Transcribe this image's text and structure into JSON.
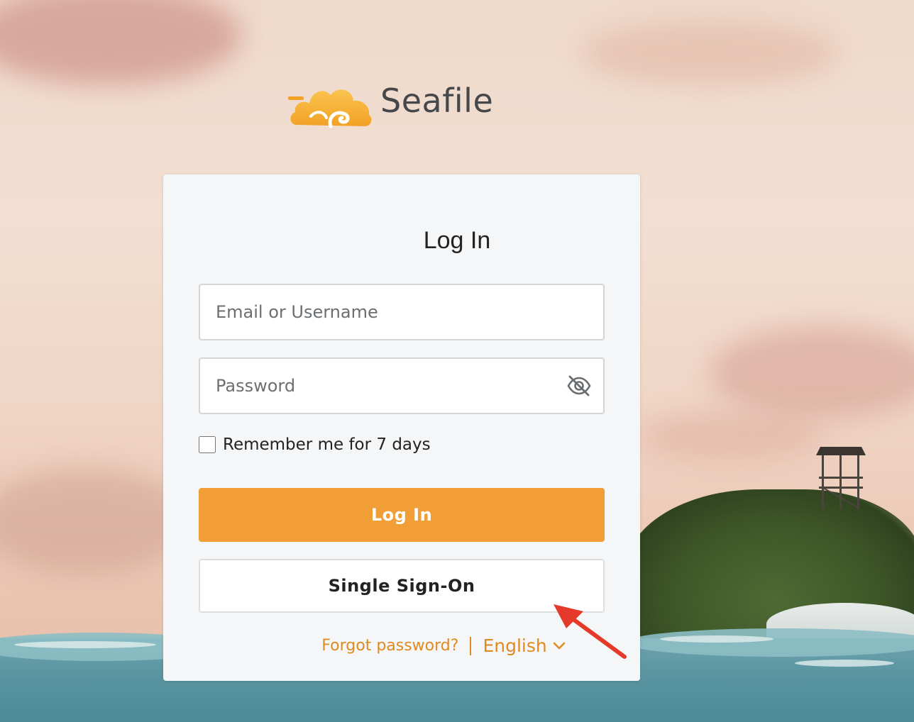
{
  "brand": {
    "name": "Seafile",
    "logo_icon": "seafile-cloud-wave-logo",
    "accent_color": "#f09e35",
    "link_color": "#e08a22"
  },
  "login": {
    "title": "Log In",
    "username_placeholder": "Email or Username",
    "password_placeholder": "Password",
    "password_toggle_icon": "eye-slash-icon",
    "remember_label": "Remember me for 7 days",
    "remember_checked": false,
    "login_button": "Log In",
    "sso_button": "Single Sign-On",
    "forgot_password": "Forgot password?",
    "language": "English",
    "language_icon": "chevron-down-icon"
  },
  "annotation": {
    "icon": "red-arrow-icon",
    "color": "#e53a2a"
  }
}
